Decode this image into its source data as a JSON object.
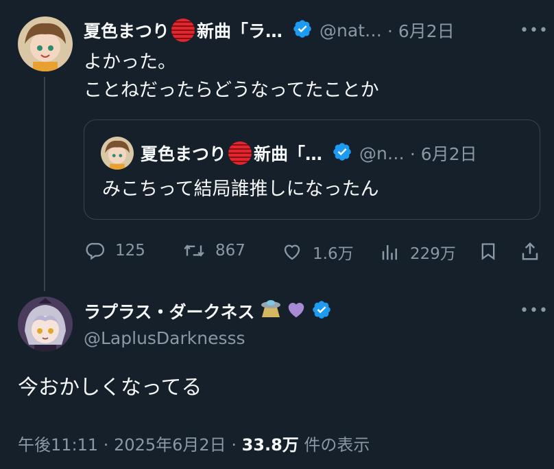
{
  "tweet1": {
    "author_name": "夏色まつり",
    "author_suffix": "新曲「ラ…",
    "handle": "@nat…",
    "date": "· 6月2日",
    "more": "•••",
    "text_line1": "よかった。",
    "text_line2": "ことねだったらどうなってたことか"
  },
  "quote": {
    "author_name": "夏色まつり",
    "author_suffix": "新曲「…",
    "handle": "@n…",
    "date": "· 6月2日",
    "text": "みこちって結局誰推しになったん"
  },
  "actions": {
    "reply_count": "125",
    "retweet_count": "867",
    "like_count": "1.6万",
    "view_count": "229万"
  },
  "tweet2": {
    "author_name": "ラプラス・ダークネス",
    "handle": "@LaplusDarknesss",
    "more": "•••",
    "text": "今おかしくなってる"
  },
  "footer": {
    "time": "午後11:11",
    "sep1": " · ",
    "date": "2025年6月2日",
    "sep2": " · ",
    "views": "33.8万",
    "views_suffix": " 件の表示"
  },
  "colors": {
    "background": "#15202b",
    "text": "#f7f9f9",
    "muted": "#8b98a5",
    "verified": "#1d9bf0",
    "border": "#38444d"
  }
}
